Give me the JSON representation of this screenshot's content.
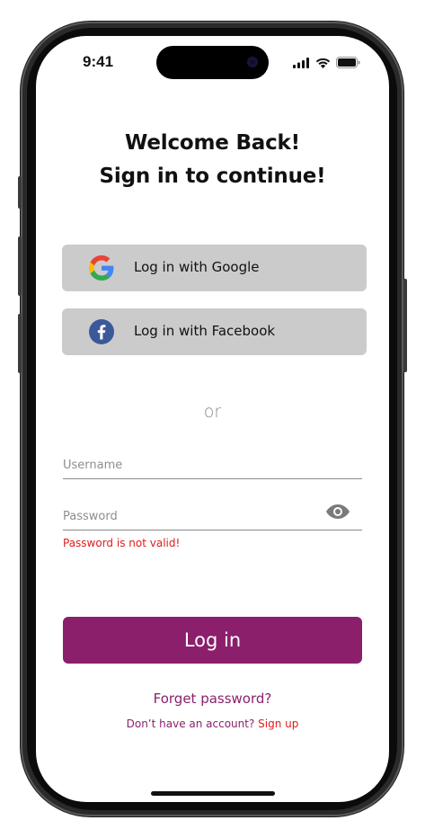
{
  "status_bar": {
    "time": "9:41"
  },
  "header": {
    "title_line1": "Welcome Back!",
    "title_line2": "Sign in to continue!"
  },
  "social": {
    "google_label": "Log in with Google",
    "google_icon": "google-icon",
    "facebook_label": "Log in with Facebook",
    "facebook_icon": "facebook-icon"
  },
  "divider_text": "or",
  "form": {
    "username_placeholder": "Username",
    "username_value": "",
    "password_placeholder": "Password",
    "password_value": "",
    "password_error": "Password is not valid!"
  },
  "actions": {
    "login_label": "Log in",
    "forgot_label": "Forget password?",
    "signup_prompt": "Don’t have an account?",
    "signup_label": "Sign up"
  },
  "colors": {
    "brand": "#8b1f6c",
    "error": "#e01b1b",
    "social_button_bg": "#cbcbcb"
  }
}
